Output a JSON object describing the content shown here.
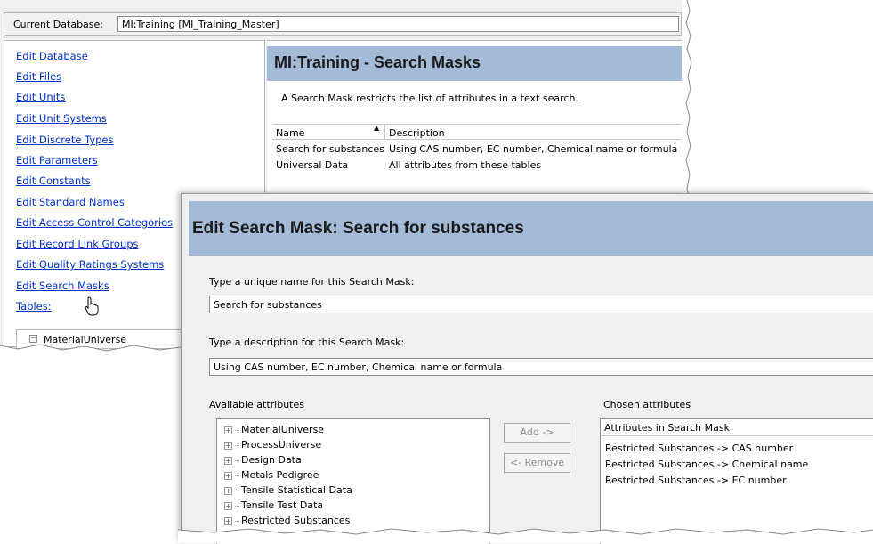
{
  "back": {
    "current_db_label": "Current Database:",
    "current_db_value": "MI:Training [MI_Training_Master]",
    "nav_links": [
      "Edit Database",
      "Edit Files",
      "Edit Units",
      "Edit Unit Systems",
      "Edit Discrete Types",
      "Edit Parameters",
      "Edit Constants",
      "Edit Standard Names",
      "Edit Access Control Categories",
      "Edit Record Link Groups",
      "Edit Quality Ratings Systems",
      "Edit Search Masks",
      "Tables:"
    ],
    "tree_root": "MaterialUniverse",
    "pane_title": "MI:Training - Search Masks",
    "pane_desc": "A Search Mask restricts the list of attributes in a text search.",
    "table": {
      "columns": [
        "Name",
        "Description"
      ],
      "rows": [
        {
          "name": "Search for substances",
          "description": "Using CAS number, EC number, Chemical name or formula"
        },
        {
          "name": "Universal Data",
          "description": "All attributes from these tables"
        }
      ]
    }
  },
  "front": {
    "title": "Edit Search Mask: Search for substances",
    "name_label": "Type a unique name for this Search Mask:",
    "name_value": "Search for substances",
    "desc_label": "Type a description for this Search Mask:",
    "desc_value": "Using CAS number, EC number, Chemical name or formula",
    "available_label": "Available attributes",
    "chosen_label": "Chosen attributes",
    "available_items": [
      "MaterialUniverse",
      "ProcessUniverse",
      "Design Data",
      "Metals Pedigree",
      "Tensile Statistical Data",
      "Tensile Test Data",
      "Restricted Substances"
    ],
    "add_label": "Add ->",
    "remove_label": "<- Remove",
    "chosen_header": "Attributes in Search Mask",
    "chosen_items": [
      "Restricted Substances -> CAS number",
      "Restricted Substances -> Chemical name",
      "Restricted Substances -> EC number"
    ]
  },
  "colors": {
    "header_bg": "#a3bbd6",
    "link": "#0033cc",
    "window_bg": "#f0f0f0"
  }
}
